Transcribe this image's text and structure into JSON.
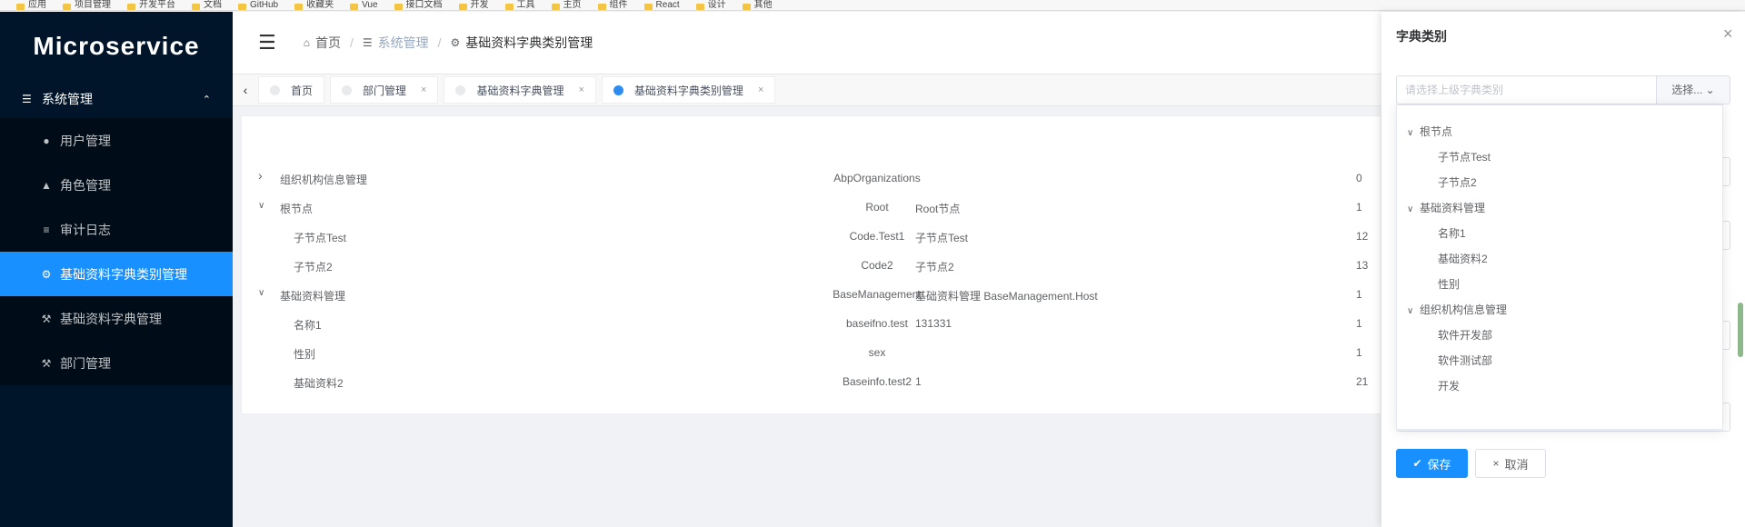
{
  "bookmarks": [
    "应用",
    "项目管理",
    "开发平台",
    "文档",
    "GitHub",
    "收藏夹",
    "Vue",
    "接口文档",
    "开发",
    "工具",
    "主页",
    "组件",
    "React",
    "设计",
    "其他"
  ],
  "sidebar": {
    "logo": "Microservice",
    "group_label": "系统管理",
    "items": [
      {
        "label": "用户管理",
        "icon": "user-icon",
        "glyph": "●"
      },
      {
        "label": "角色管理",
        "icon": "role-icon",
        "glyph": "▲"
      },
      {
        "label": "审计日志",
        "icon": "list-icon",
        "glyph": "≡"
      },
      {
        "label": "基础资料字典类别管理",
        "icon": "gear-icon",
        "glyph": "⚙",
        "active": true
      },
      {
        "label": "基础资料字典管理",
        "icon": "hammer-icon",
        "glyph": "⚒"
      },
      {
        "label": "部门管理",
        "icon": "wrench-icon",
        "glyph": "⚒"
      }
    ]
  },
  "breadcrumb": [
    "首页",
    "系统管理",
    "基础资料字典类别管理"
  ],
  "tags": [
    {
      "label": "首页",
      "closable": false
    },
    {
      "label": "部门管理",
      "closable": true
    },
    {
      "label": "基础资料字典管理",
      "closable": true
    },
    {
      "label": "基础资料字典类别管理",
      "closable": true,
      "active": true
    }
  ],
  "table": {
    "rows": [
      {
        "name": "组织机构信息管理",
        "code": "AbpOrganizations",
        "remark": "",
        "sort": "0",
        "level": 0,
        "expand": "right"
      },
      {
        "name": "根节点",
        "code": "Root",
        "remark": "Root节点",
        "sort": "1",
        "level": 0,
        "expand": "down"
      },
      {
        "name": "子节点Test",
        "code": "Code.Test1",
        "remark": "子节点Test",
        "sort": "12",
        "level": 1,
        "expand": ""
      },
      {
        "name": "子节点2",
        "code": "Code2",
        "remark": "子节点2",
        "sort": "13",
        "level": 1,
        "expand": ""
      },
      {
        "name": "基础资料管理",
        "code": "BaseManagement",
        "remark": "基础资料管理 BaseManagement.Host",
        "sort": "1",
        "level": 0,
        "expand": "down"
      },
      {
        "name": "名称1",
        "code": "baseifno.test",
        "remark": "131331",
        "sort": "1",
        "level": 1,
        "expand": ""
      },
      {
        "name": "性别",
        "code": "sex",
        "remark": "",
        "sort": "1",
        "level": 1,
        "expand": ""
      },
      {
        "name": "基础资料2",
        "code": "Baseinfo.test2",
        "remark": "1",
        "sort": "21",
        "level": 1,
        "expand": ""
      }
    ]
  },
  "drawer": {
    "title": "字典类别",
    "parent_placeholder": "请选择上级字典类别",
    "select_label": "选择...",
    "tree": [
      {
        "label": "根节点",
        "level": 0
      },
      {
        "label": "子节点Test",
        "level": 1
      },
      {
        "label": "子节点2",
        "level": 1
      },
      {
        "label": "基础资料管理",
        "level": 0
      },
      {
        "label": "名称1",
        "level": 1
      },
      {
        "label": "基础资料2",
        "level": 1
      },
      {
        "label": "性别",
        "level": 1
      },
      {
        "label": "组织机构信息管理",
        "level": 0
      },
      {
        "label": "软件开发部",
        "level": 1
      },
      {
        "label": "软件测试部",
        "level": 1
      },
      {
        "label": "开发",
        "level": 1
      }
    ],
    "save_label": "保存",
    "cancel_label": "取消"
  },
  "colors": {
    "sidebar_bg": "#001529",
    "accent": "#1890ff"
  }
}
